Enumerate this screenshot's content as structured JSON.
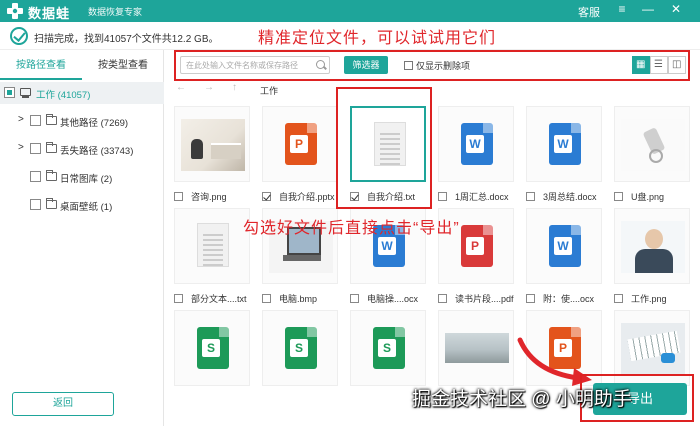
{
  "titlebar": {
    "brand": "数据蛙",
    "subtitle": "数据恢复专家",
    "service": "客服",
    "controls": {
      "menu": "≡",
      "minimize": "—",
      "close": "✕"
    }
  },
  "scan": {
    "status": "扫描完成，找到41057个文件共12.2 GB。"
  },
  "annotations": {
    "top": "精准定位文件，可以试试用它们",
    "middle": "勾选好文件后直接点击“导出”",
    "watermark": "掘金技术社区 @ 小明助手"
  },
  "sidebar": {
    "tabs": [
      {
        "label": "按路径查看",
        "active": true
      },
      {
        "label": "按类型查看",
        "active": false
      }
    ],
    "tree": [
      {
        "label": "工作 (41057)",
        "selected": true
      },
      {
        "label": "其他路径 (7269)",
        "expandable": true
      },
      {
        "label": "丢失路径 (33743)",
        "expandable": true
      },
      {
        "label": "日常图库 (2)"
      },
      {
        "label": "桌面壁纸 (1)"
      }
    ],
    "back_label": "返回"
  },
  "toolbar": {
    "search_placeholder": "在此处输入文件名称或保存路径",
    "filter_label": "筛选器",
    "only_deleted_label": "仅显示删除项",
    "views": {
      "grid": "▦",
      "list": "☰",
      "detail": "◫"
    }
  },
  "nav": {
    "back": "←",
    "forward": "→",
    "up": "↑",
    "crumb": "工作"
  },
  "files": [
    {
      "name": "咨询.png",
      "kind": "photo-office",
      "checked": false
    },
    {
      "name": "自我介绍.pptx",
      "kind": "ppt",
      "checked": true
    },
    {
      "name": "自我介绍.txt",
      "kind": "txt",
      "checked": true,
      "highlighted": true
    },
    {
      "name": "1周汇总.docx",
      "kind": "word",
      "checked": false
    },
    {
      "name": "3周总结.docx",
      "kind": "word",
      "checked": false
    },
    {
      "name": "U盘.png",
      "kind": "photo-usb",
      "checked": false
    },
    {
      "name": "部分文本....txt",
      "kind": "txt",
      "checked": false
    },
    {
      "name": "电脑.bmp",
      "kind": "photo-comp",
      "checked": false
    },
    {
      "name": "电脑操....ocx",
      "kind": "word",
      "checked": false
    },
    {
      "name": "读书片段....pdf",
      "kind": "pdf",
      "checked": false
    },
    {
      "name": "附：使....ocx",
      "kind": "word",
      "checked": false
    },
    {
      "name": "工作.png",
      "kind": "photo-agent",
      "checked": false
    },
    {
      "name": "",
      "kind": "xls",
      "checked": false
    },
    {
      "name": "",
      "kind": "xls",
      "checked": false
    },
    {
      "name": "",
      "kind": "xls",
      "checked": false
    },
    {
      "name": "",
      "kind": "photo-land",
      "checked": false
    },
    {
      "name": "",
      "kind": "ppt",
      "checked": false
    },
    {
      "name": "",
      "kind": "photo-kbd",
      "checked": false
    }
  ],
  "footer": {
    "export_label": "导出"
  }
}
